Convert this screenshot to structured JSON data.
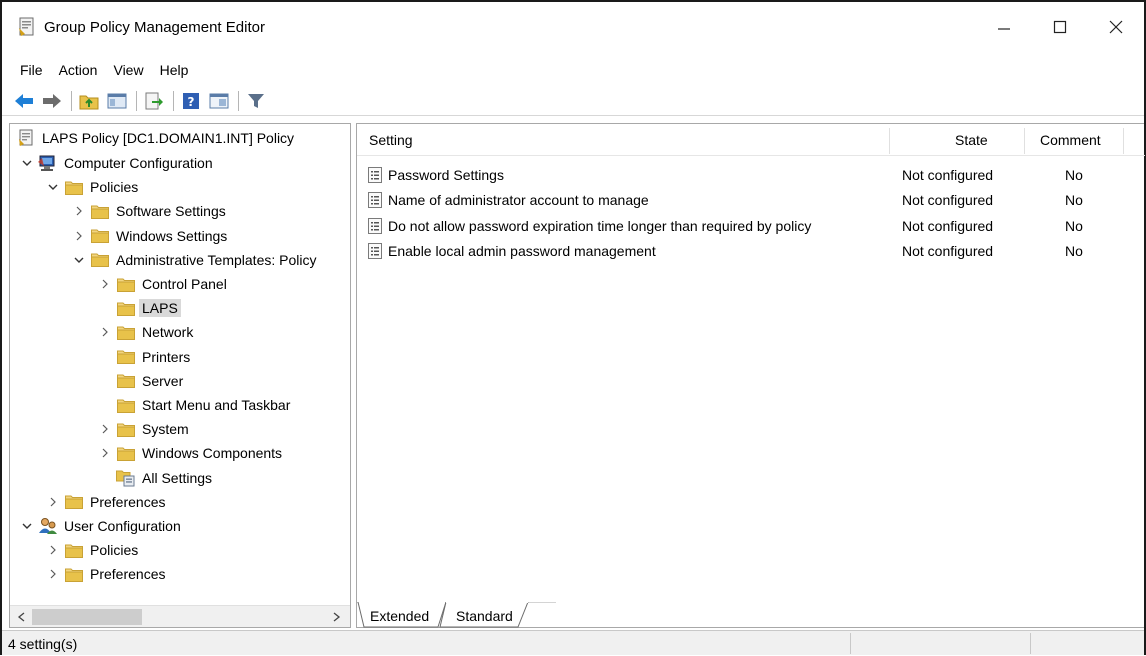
{
  "window": {
    "title": "Group Policy Management Editor",
    "controls": [
      "minimize",
      "maximize",
      "close"
    ]
  },
  "menu": {
    "items": [
      "File",
      "Action",
      "View",
      "Help"
    ]
  },
  "toolbar": {
    "icons": [
      "back-arrow-icon",
      "forward-arrow-icon",
      "up-folder-icon",
      "show-hide-tree-icon",
      "export-list-icon",
      "help-icon",
      "properties-icon",
      "filter-icon"
    ]
  },
  "tree": {
    "root": "LAPS Policy [DC1.DOMAIN1.INT] Policy",
    "items": [
      {
        "label": "Computer Configuration",
        "icon": "computer-config-icon",
        "expanded": true
      },
      {
        "label": "Policies",
        "icon": "folder-icon",
        "expanded": true
      },
      {
        "label": "Software Settings",
        "icon": "folder-icon",
        "expanded": false
      },
      {
        "label": "Windows Settings",
        "icon": "folder-icon",
        "expanded": false
      },
      {
        "label": "Administrative Templates: Policy",
        "icon": "folder-icon",
        "expanded": true
      },
      {
        "label": "Control Panel",
        "icon": "folder-icon",
        "expanded": false
      },
      {
        "label": "LAPS",
        "icon": "folder-icon",
        "selected": true
      },
      {
        "label": "Network",
        "icon": "folder-icon",
        "expanded": false
      },
      {
        "label": "Printers",
        "icon": "folder-icon"
      },
      {
        "label": "Server",
        "icon": "folder-icon"
      },
      {
        "label": "Start Menu and Taskbar",
        "icon": "folder-icon"
      },
      {
        "label": "System",
        "icon": "folder-icon",
        "expanded": false
      },
      {
        "label": "Windows Components",
        "icon": "folder-icon",
        "expanded": false
      },
      {
        "label": "All Settings",
        "icon": "all-settings-icon"
      },
      {
        "label": "Preferences",
        "icon": "folder-icon",
        "expanded": false
      },
      {
        "label": "User Configuration",
        "icon": "user-config-icon",
        "expanded": true
      },
      {
        "label": "Policies",
        "icon": "folder-icon",
        "expanded": false
      },
      {
        "label": "Preferences",
        "icon": "folder-icon",
        "expanded": false
      }
    ]
  },
  "list": {
    "columns": [
      "Setting",
      "State",
      "Comment"
    ],
    "rows": [
      {
        "setting": "Password Settings",
        "state": "Not configured",
        "comment": "No"
      },
      {
        "setting": "Name of administrator account to manage",
        "state": "Not configured",
        "comment": "No"
      },
      {
        "setting": "Do not allow password expiration time longer than required by policy",
        "state": "Not configured",
        "comment": "No"
      },
      {
        "setting": "Enable local admin password management",
        "state": "Not configured",
        "comment": "No"
      }
    ]
  },
  "tabs": {
    "items": [
      "Extended",
      "Standard"
    ],
    "active": "Standard"
  },
  "status": {
    "text": "4 setting(s)"
  },
  "colors": {
    "folder": "#e8c24a",
    "selection": "#d9d9d9",
    "arrow_blue": "#1e7fd6"
  }
}
